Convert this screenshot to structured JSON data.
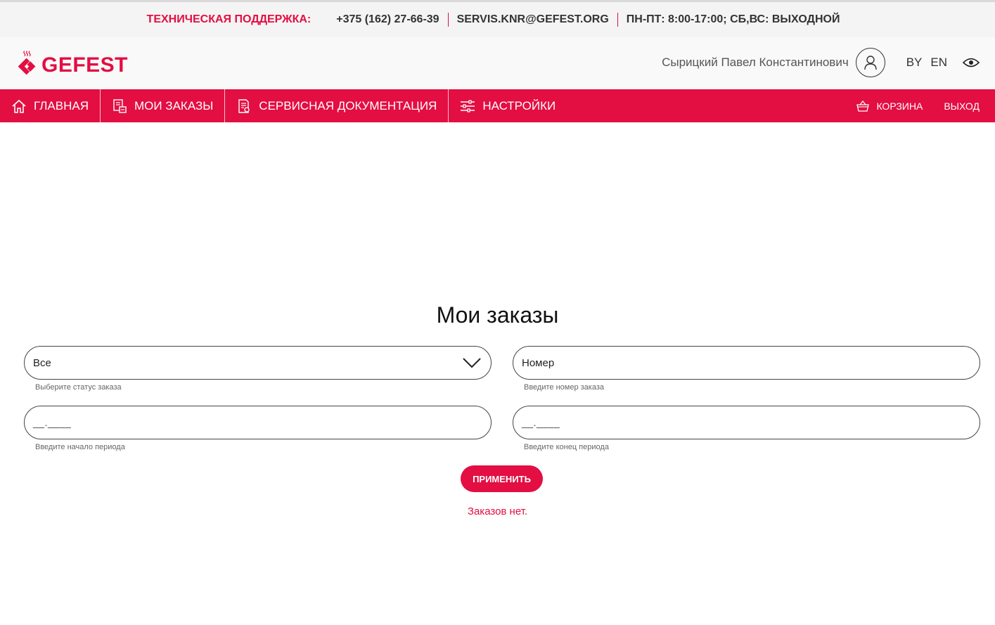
{
  "support": {
    "label": "ТЕХНИЧЕСКАЯ ПОДДЕРЖКА:",
    "phone": "+375 (162) 27-66-39",
    "email": "SERVIS.KNR@GEFEST.ORG",
    "hours": "ПН-ПТ: 8:00-17:00; СБ,ВС: ВЫХОДНОЙ"
  },
  "header": {
    "logo_text": "GEFEST",
    "user_name": "Сырицкий Павел Константинович",
    "languages": [
      "BY",
      "EN"
    ]
  },
  "nav": {
    "items": [
      {
        "label": "ГЛАВНАЯ",
        "icon": "home-icon"
      },
      {
        "label": "МОИ ЗАКАЗЫ",
        "icon": "orders-icon"
      },
      {
        "label": "СЕРВИСНАЯ ДОКУМЕНТАЦИЯ",
        "icon": "documentation-icon"
      },
      {
        "label": "НАСТРОЙКИ",
        "icon": "settings-sliders-icon"
      }
    ],
    "cart_label": "КОРЗИНА",
    "logout_label": "ВЫХОД"
  },
  "main": {
    "title": "Мои заказы",
    "status_select": {
      "value": "Все",
      "hint": "Выберите статус заказа"
    },
    "order_number": {
      "placeholder": "Номер",
      "hint": "Введите номер заказа"
    },
    "period_start": {
      "mask": "__.____",
      "hint": "Введите начало периода"
    },
    "period_end": {
      "mask": "__.____",
      "hint": "Введите конец периода"
    },
    "apply_label": "ПРИМЕНИТЬ",
    "empty_message": "Заказов нет."
  },
  "colors": {
    "brand": "#e30e42",
    "support_bar_bg": "#f4f4f4",
    "header_bg": "#f9f9f9"
  }
}
